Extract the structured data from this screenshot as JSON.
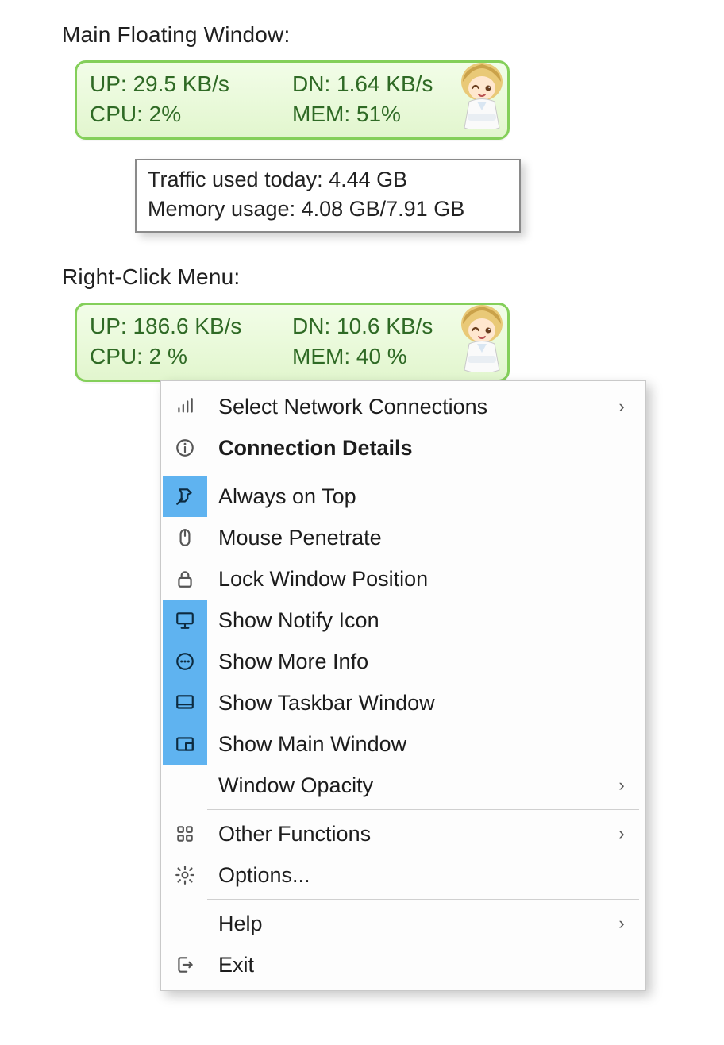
{
  "sections": {
    "main_title": "Main Floating Window:",
    "menu_title": "Right-Click Menu:"
  },
  "widget1": {
    "up": "UP: 29.5 KB/s",
    "dn": "DN: 1.64 KB/s",
    "cpu": "CPU: 2%",
    "mem": "MEM: 51%"
  },
  "tooltip": {
    "line1": "Traffic used today: 4.44 GB",
    "line2": "Memory usage: 4.08 GB/7.91 GB"
  },
  "widget2": {
    "up": "UP: 186.6 KB/s",
    "dn": "DN: 10.6 KB/s",
    "cpu": "CPU: 2 %",
    "mem": "MEM: 40 %"
  },
  "menu": {
    "items": [
      {
        "icon": "signal-icon",
        "label": "Select Network Connections",
        "bold": false,
        "selected": false,
        "submenu": true
      },
      {
        "icon": "info-icon",
        "label": "Connection Details",
        "bold": true,
        "selected": false,
        "submenu": false
      },
      {
        "separator": true
      },
      {
        "icon": "pin-icon",
        "label": "Always on Top",
        "bold": false,
        "selected": true,
        "submenu": false
      },
      {
        "icon": "mouse-icon",
        "label": "Mouse Penetrate",
        "bold": false,
        "selected": false,
        "submenu": false
      },
      {
        "icon": "lock-icon",
        "label": "Lock Window Position",
        "bold": false,
        "selected": false,
        "submenu": false
      },
      {
        "icon": "monitor-stand-icon",
        "label": "Show Notify Icon",
        "bold": false,
        "selected": true,
        "submenu": false
      },
      {
        "icon": "more-info-icon",
        "label": "Show More Info",
        "bold": false,
        "selected": true,
        "submenu": false
      },
      {
        "icon": "taskbar-icon",
        "label": "Show Taskbar Window",
        "bold": false,
        "selected": true,
        "submenu": false
      },
      {
        "icon": "window-icon",
        "label": "Show Main Window",
        "bold": false,
        "selected": true,
        "submenu": false
      },
      {
        "icon": "",
        "label": "Window Opacity",
        "bold": false,
        "selected": false,
        "submenu": true
      },
      {
        "separator": true
      },
      {
        "icon": "grid-icon",
        "label": "Other Functions",
        "bold": false,
        "selected": false,
        "submenu": true
      },
      {
        "icon": "gear-icon",
        "label": "Options...",
        "bold": false,
        "selected": false,
        "submenu": false
      },
      {
        "separator": true
      },
      {
        "icon": "",
        "label": "Help",
        "bold": false,
        "selected": false,
        "submenu": true
      },
      {
        "icon": "exit-icon",
        "label": "Exit",
        "bold": false,
        "selected": false,
        "submenu": false
      }
    ]
  },
  "colors": {
    "widget_border": "#84cf5a",
    "widget_text": "#2f6a25",
    "menu_highlight": "#5fb3f0"
  }
}
